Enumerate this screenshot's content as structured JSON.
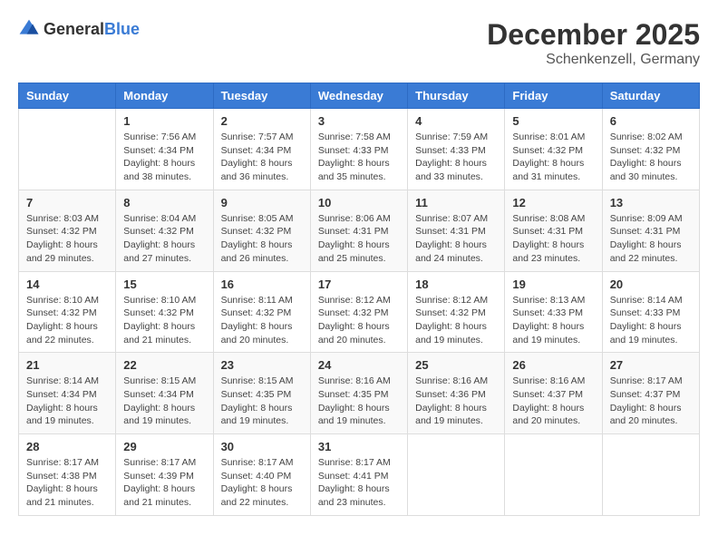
{
  "header": {
    "logo_general": "General",
    "logo_blue": "Blue",
    "month_title": "December 2025",
    "location": "Schenkenzell, Germany"
  },
  "weekdays": [
    "Sunday",
    "Monday",
    "Tuesday",
    "Wednesday",
    "Thursday",
    "Friday",
    "Saturday"
  ],
  "weeks": [
    [
      {
        "day": "",
        "info": ""
      },
      {
        "day": "1",
        "info": "Sunrise: 7:56 AM\nSunset: 4:34 PM\nDaylight: 8 hours\nand 38 minutes."
      },
      {
        "day": "2",
        "info": "Sunrise: 7:57 AM\nSunset: 4:34 PM\nDaylight: 8 hours\nand 36 minutes."
      },
      {
        "day": "3",
        "info": "Sunrise: 7:58 AM\nSunset: 4:33 PM\nDaylight: 8 hours\nand 35 minutes."
      },
      {
        "day": "4",
        "info": "Sunrise: 7:59 AM\nSunset: 4:33 PM\nDaylight: 8 hours\nand 33 minutes."
      },
      {
        "day": "5",
        "info": "Sunrise: 8:01 AM\nSunset: 4:32 PM\nDaylight: 8 hours\nand 31 minutes."
      },
      {
        "day": "6",
        "info": "Sunrise: 8:02 AM\nSunset: 4:32 PM\nDaylight: 8 hours\nand 30 minutes."
      }
    ],
    [
      {
        "day": "7",
        "info": "Sunrise: 8:03 AM\nSunset: 4:32 PM\nDaylight: 8 hours\nand 29 minutes."
      },
      {
        "day": "8",
        "info": "Sunrise: 8:04 AM\nSunset: 4:32 PM\nDaylight: 8 hours\nand 27 minutes."
      },
      {
        "day": "9",
        "info": "Sunrise: 8:05 AM\nSunset: 4:32 PM\nDaylight: 8 hours\nand 26 minutes."
      },
      {
        "day": "10",
        "info": "Sunrise: 8:06 AM\nSunset: 4:31 PM\nDaylight: 8 hours\nand 25 minutes."
      },
      {
        "day": "11",
        "info": "Sunrise: 8:07 AM\nSunset: 4:31 PM\nDaylight: 8 hours\nand 24 minutes."
      },
      {
        "day": "12",
        "info": "Sunrise: 8:08 AM\nSunset: 4:31 PM\nDaylight: 8 hours\nand 23 minutes."
      },
      {
        "day": "13",
        "info": "Sunrise: 8:09 AM\nSunset: 4:31 PM\nDaylight: 8 hours\nand 22 minutes."
      }
    ],
    [
      {
        "day": "14",
        "info": "Sunrise: 8:10 AM\nSunset: 4:32 PM\nDaylight: 8 hours\nand 22 minutes."
      },
      {
        "day": "15",
        "info": "Sunrise: 8:10 AM\nSunset: 4:32 PM\nDaylight: 8 hours\nand 21 minutes."
      },
      {
        "day": "16",
        "info": "Sunrise: 8:11 AM\nSunset: 4:32 PM\nDaylight: 8 hours\nand 20 minutes."
      },
      {
        "day": "17",
        "info": "Sunrise: 8:12 AM\nSunset: 4:32 PM\nDaylight: 8 hours\nand 20 minutes."
      },
      {
        "day": "18",
        "info": "Sunrise: 8:12 AM\nSunset: 4:32 PM\nDaylight: 8 hours\nand 19 minutes."
      },
      {
        "day": "19",
        "info": "Sunrise: 8:13 AM\nSunset: 4:33 PM\nDaylight: 8 hours\nand 19 minutes."
      },
      {
        "day": "20",
        "info": "Sunrise: 8:14 AM\nSunset: 4:33 PM\nDaylight: 8 hours\nand 19 minutes."
      }
    ],
    [
      {
        "day": "21",
        "info": "Sunrise: 8:14 AM\nSunset: 4:34 PM\nDaylight: 8 hours\nand 19 minutes."
      },
      {
        "day": "22",
        "info": "Sunrise: 8:15 AM\nSunset: 4:34 PM\nDaylight: 8 hours\nand 19 minutes."
      },
      {
        "day": "23",
        "info": "Sunrise: 8:15 AM\nSunset: 4:35 PM\nDaylight: 8 hours\nand 19 minutes."
      },
      {
        "day": "24",
        "info": "Sunrise: 8:16 AM\nSunset: 4:35 PM\nDaylight: 8 hours\nand 19 minutes."
      },
      {
        "day": "25",
        "info": "Sunrise: 8:16 AM\nSunset: 4:36 PM\nDaylight: 8 hours\nand 19 minutes."
      },
      {
        "day": "26",
        "info": "Sunrise: 8:16 AM\nSunset: 4:37 PM\nDaylight: 8 hours\nand 20 minutes."
      },
      {
        "day": "27",
        "info": "Sunrise: 8:17 AM\nSunset: 4:37 PM\nDaylight: 8 hours\nand 20 minutes."
      }
    ],
    [
      {
        "day": "28",
        "info": "Sunrise: 8:17 AM\nSunset: 4:38 PM\nDaylight: 8 hours\nand 21 minutes."
      },
      {
        "day": "29",
        "info": "Sunrise: 8:17 AM\nSunset: 4:39 PM\nDaylight: 8 hours\nand 21 minutes."
      },
      {
        "day": "30",
        "info": "Sunrise: 8:17 AM\nSunset: 4:40 PM\nDaylight: 8 hours\nand 22 minutes."
      },
      {
        "day": "31",
        "info": "Sunrise: 8:17 AM\nSunset: 4:41 PM\nDaylight: 8 hours\nand 23 minutes."
      },
      {
        "day": "",
        "info": ""
      },
      {
        "day": "",
        "info": ""
      },
      {
        "day": "",
        "info": ""
      }
    ]
  ]
}
